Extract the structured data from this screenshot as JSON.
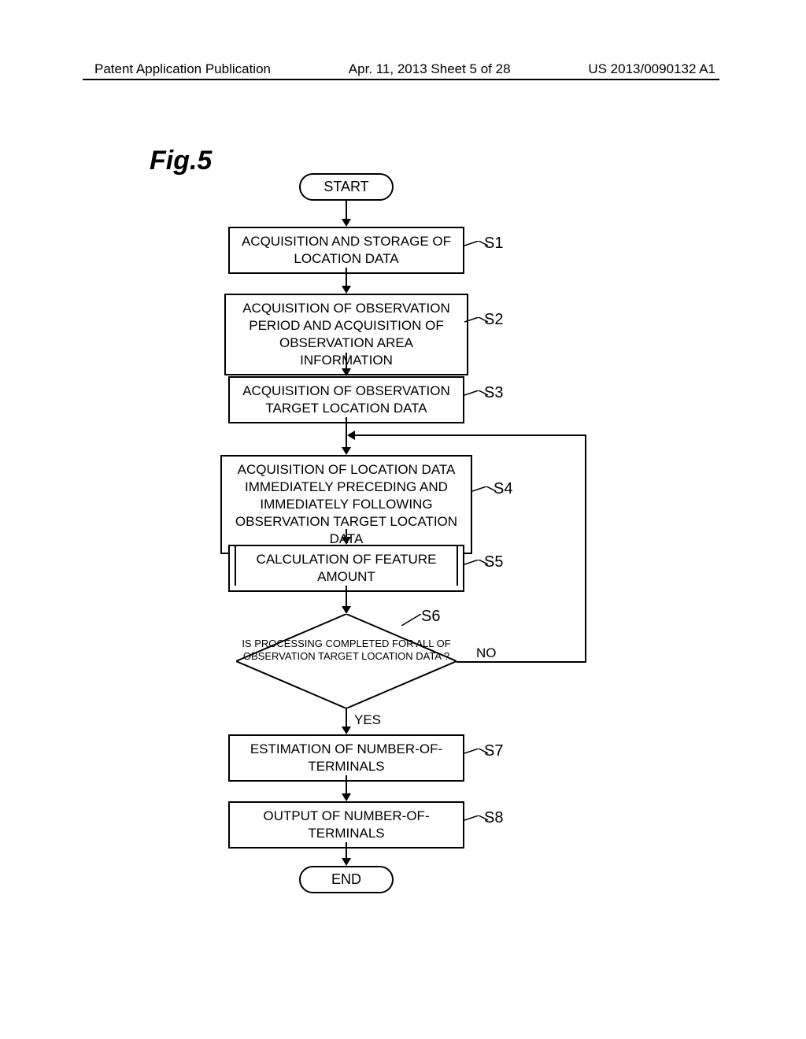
{
  "header": {
    "left": "Patent Application Publication",
    "center": "Apr. 11, 2013  Sheet 5 of 28",
    "right": "US 2013/0090132 A1"
  },
  "figure_label": "Fig.5",
  "chart_data": {
    "type": "flowchart",
    "nodes": [
      {
        "id": "start",
        "type": "terminal",
        "text": "START"
      },
      {
        "id": "s1",
        "type": "process",
        "text": "ACQUISITION AND STORAGE OF LOCATION DATA",
        "label": "S1"
      },
      {
        "id": "s2",
        "type": "process",
        "text": "ACQUISITION OF OBSERVATION PERIOD AND ACQUISITION OF OBSERVATION AREA INFORMATION",
        "label": "S2"
      },
      {
        "id": "s3",
        "type": "process",
        "text": "ACQUISITION OF OBSERVATION TARGET LOCATION DATA",
        "label": "S3"
      },
      {
        "id": "s4",
        "type": "process",
        "text": "ACQUISITION OF LOCATION DATA IMMEDIATELY PRECEDING AND IMMEDIATELY FOLLOWING OBSERVATION TARGET LOCATION DATA",
        "label": "S4"
      },
      {
        "id": "s5",
        "type": "predefined-process",
        "text": "CALCULATION OF FEATURE AMOUNT",
        "label": "S5"
      },
      {
        "id": "s6",
        "type": "decision",
        "text": "IS PROCESSING COMPLETED FOR ALL OF OBSERVATION TARGET LOCATION DATA ?",
        "label": "S6",
        "yes_to": "s7",
        "no_to": "s4"
      },
      {
        "id": "s7",
        "type": "process",
        "text": "ESTIMATION OF NUMBER-OF-TERMINALS",
        "label": "S7"
      },
      {
        "id": "s8",
        "type": "process",
        "text": "OUTPUT OF NUMBER-OF-TERMINALS",
        "label": "S8"
      },
      {
        "id": "end",
        "type": "terminal",
        "text": "END"
      }
    ],
    "yes_label": "YES",
    "no_label": "NO"
  }
}
